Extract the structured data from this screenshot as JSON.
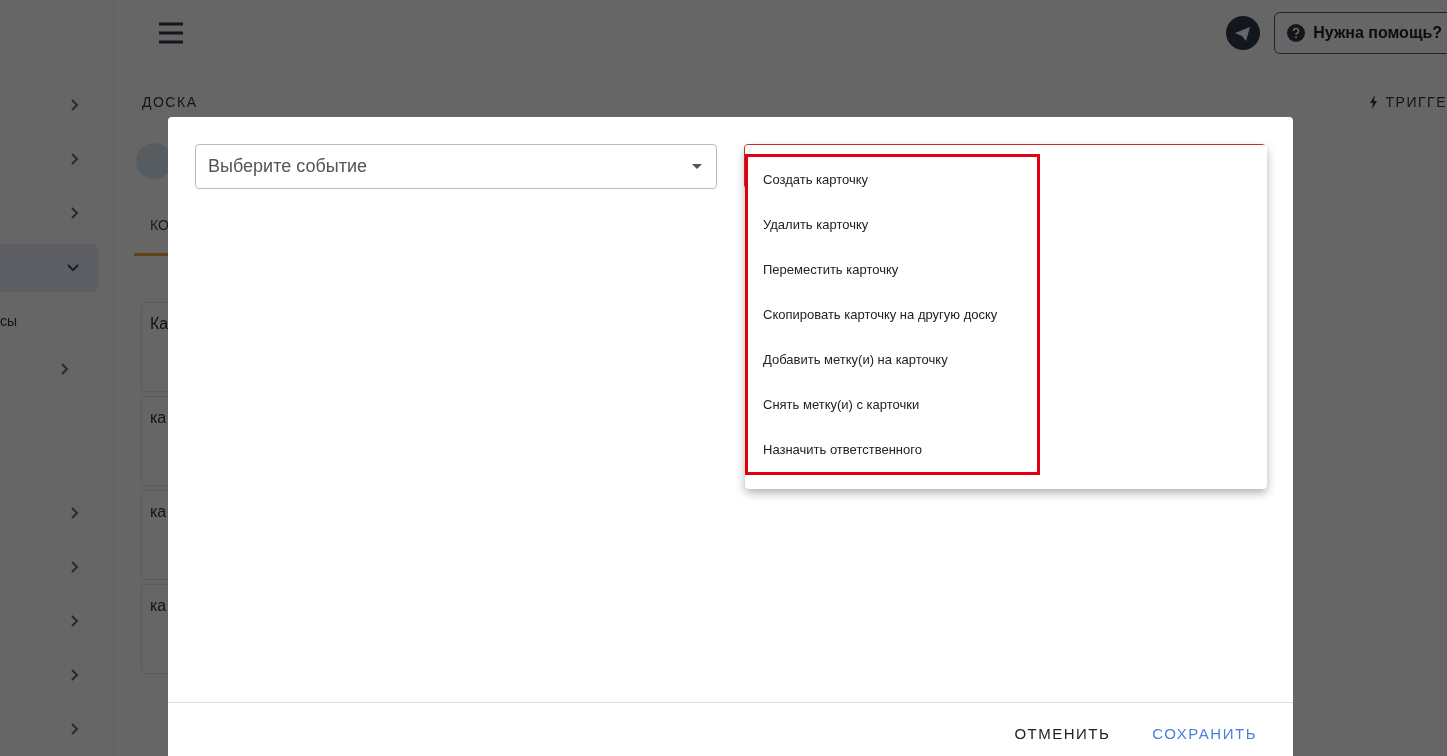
{
  "sidebar": {
    "items": [
      {
        "expanded": false,
        "selected": false
      },
      {
        "expanded": false,
        "selected": false
      },
      {
        "expanded": false,
        "selected": false
      },
      {
        "expanded": true,
        "selected": true,
        "children": [
          {
            "label": "сы"
          },
          {
            "expanded": false
          }
        ]
      },
      {
        "expanded": false,
        "selected": false
      },
      {
        "expanded": false,
        "selected": false
      },
      {
        "expanded": false,
        "selected": false
      },
      {
        "expanded": false,
        "selected": false
      },
      {
        "expanded": false,
        "selected": false
      }
    ]
  },
  "header": {
    "help_button": "Нужна помощь?"
  },
  "board": {
    "title": "ДОСКА",
    "triggers": "ТРИГГЕ",
    "tabs": [
      {
        "label": "КО",
        "selected": true
      }
    ],
    "cards": [
      {
        "title": "Ка"
      },
      {
        "title": "ка"
      },
      {
        "title": "ка"
      },
      {
        "title": "ка"
      }
    ]
  },
  "dialog": {
    "event_select": {
      "placeholder": "Выберите событие"
    },
    "action_select": {
      "invalid": true,
      "highlighted": true,
      "menu": [
        {
          "label": "Создать карточку"
        },
        {
          "label": "Удалить карточку"
        },
        {
          "label": "Переместить карточку"
        },
        {
          "label": "Скопировать карточку на другую доску"
        },
        {
          "label": "Добавить метку(и) на карточку"
        },
        {
          "label": "Снять метку(и) с карточки"
        },
        {
          "label": "Назначить ответственного"
        }
      ]
    },
    "buttons": [
      {
        "label": "ОТМЕНИТЬ",
        "kind": "text"
      },
      {
        "label": "СОХРАНИТЬ",
        "kind": "primary"
      }
    ]
  }
}
